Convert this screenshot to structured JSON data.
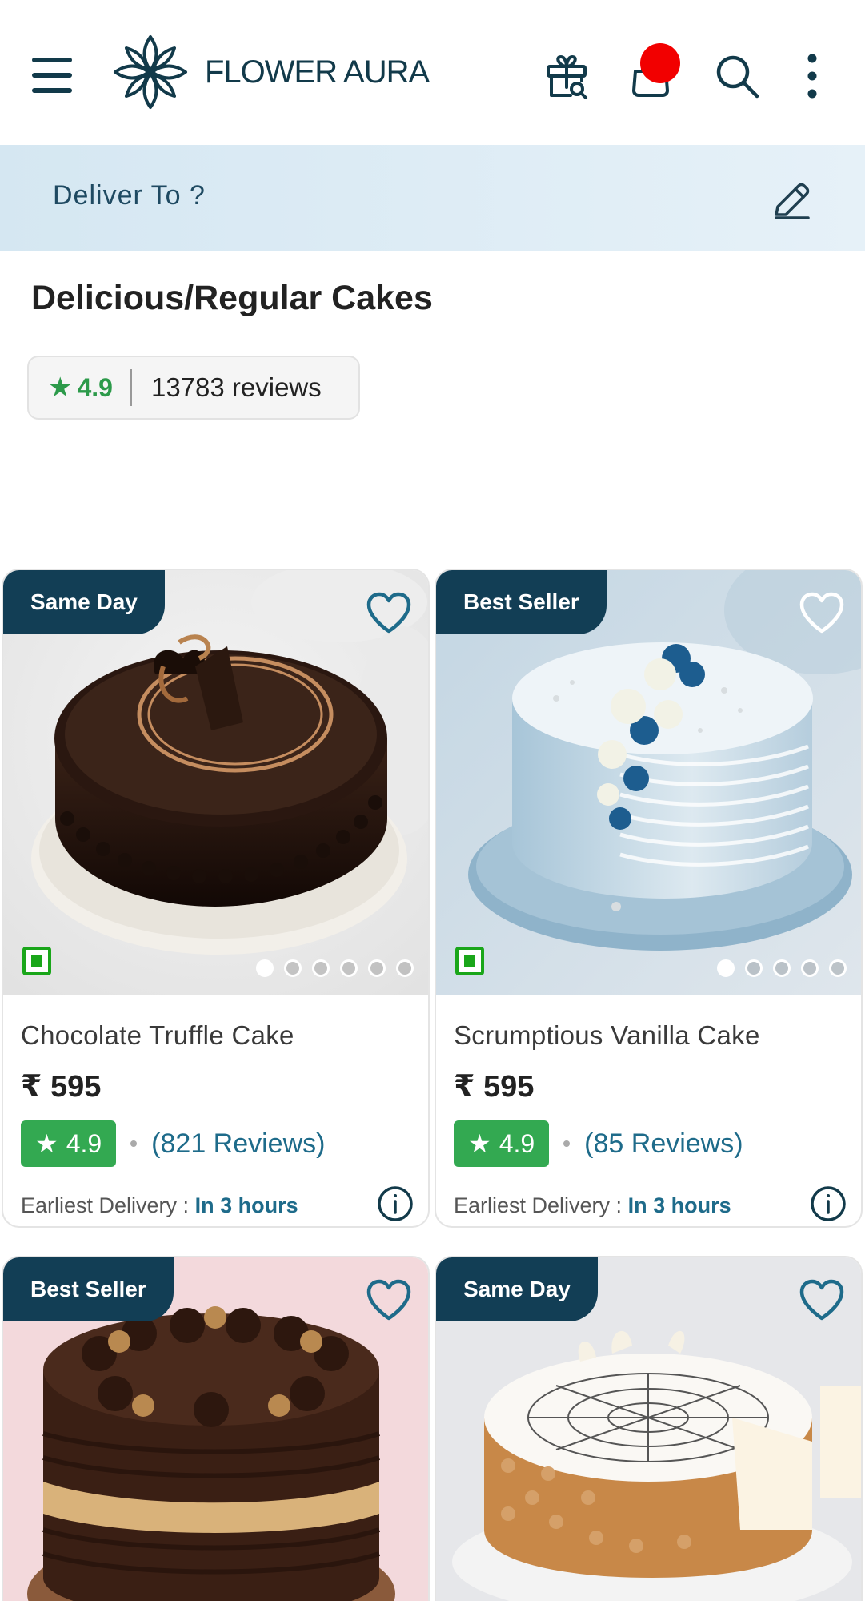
{
  "header": {
    "logo_text": "FLOWER AURA",
    "icons": [
      "menu-icon",
      "gift-search-icon",
      "cart-icon",
      "search-icon",
      "more-vertical-icon"
    ],
    "brand_color": "#123a4a",
    "cart_dot_color": "#f20000"
  },
  "deliver": {
    "label": "Deliver To ?",
    "icon": "edit-pencil-icon"
  },
  "page": {
    "title": "Delicious/Regular Cakes",
    "rating": "4.9",
    "reviews": "13783 reviews"
  },
  "products": [
    {
      "badge": "Same Day",
      "name": "Chocolate Truffle Cake",
      "price": "₹ 595",
      "rating": "4.9",
      "reviews": "(821 Reviews)",
      "delivery_label": "Earliest Delivery :",
      "delivery_value": "In 3 hours",
      "image_dots": 6,
      "active_dot": 0
    },
    {
      "badge": "Best Seller",
      "name": "Scrumptious Vanilla Cake",
      "price": "₹ 595",
      "rating": "4.9",
      "reviews": "(85 Reviews)",
      "delivery_label": "Earliest Delivery :",
      "delivery_value": "In 3 hours",
      "image_dots": 5,
      "active_dot": 0
    },
    {
      "badge": "Best Seller"
    },
    {
      "badge": "Same Day"
    }
  ],
  "colors": {
    "rating_green": "#33a951",
    "link_teal": "#1e6b8a",
    "badge_navy": "#123e55",
    "veg_green": "#1aa61a"
  }
}
